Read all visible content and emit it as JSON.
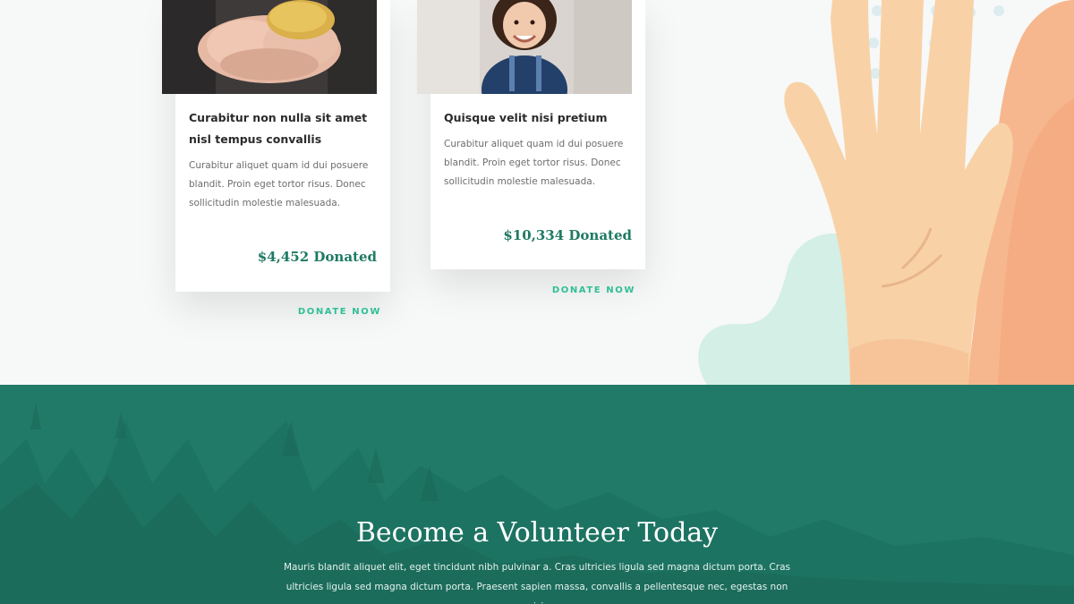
{
  "cards": [
    {
      "title": "Curabitur non nulla sit amet nisl tempus convallis",
      "text": "Curabitur aliquet quam id dui posuere blandit. Proin eget tortor risus. Donec sollicitudin molestie malesuada.",
      "amount": "$4,452 Donated",
      "cta": "DONATE NOW",
      "image": "hands-holding-coin-photo"
    },
    {
      "title": "Quisque velit nisi pretium",
      "text": "Curabitur aliquet quam id dui posuere blandit. Proin eget tortor risus. Donec sollicitudin molestie malesuada.",
      "amount": "$10,334 Donated",
      "cta": "DONATE NOW",
      "image": "smiling-child-photo"
    }
  ],
  "volunteer": {
    "title": "Become a Volunteer Today",
    "text": "Mauris blandit aliquet elit, eget tincidunt nibh pulvinar a. Cras ultricies ligula sed magna dictum porta. Cras ultricies ligula sed magna dictum porta. Praesent sapien massa, convallis a pellentesque nec, egestas non nisi."
  },
  "colors": {
    "accent": "#2fbf95",
    "amount": "#1f7a63",
    "band": "#217a68",
    "page_bg": "#f7f8f8"
  },
  "illustration": "raised-hands-illustration"
}
